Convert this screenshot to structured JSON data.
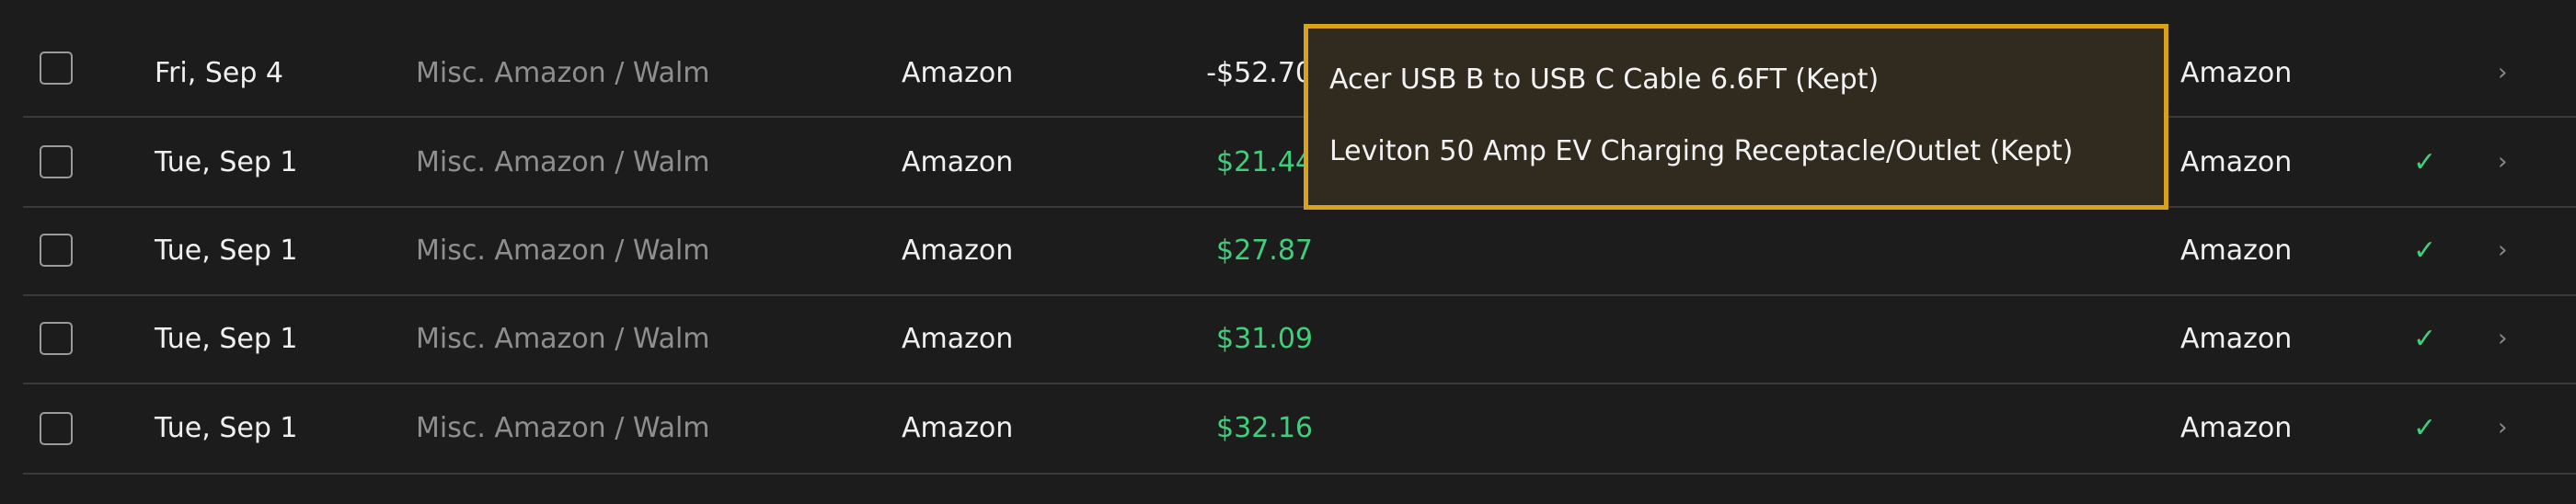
{
  "transactions": [
    {
      "date": "Fri, Sep 4",
      "category": "Misc. Amazon / Walm",
      "merchant": "Amazon",
      "amount": "-$52.70",
      "account": "Amazon",
      "reviewed": false,
      "check": "",
      "chevron": "›",
      "amount_color": "#f0f0f0"
    },
    {
      "date": "Tue, Sep 1",
      "category": "Misc. Amazon / Walm",
      "merchant": "Amazon",
      "amount": "$21.44",
      "account": "Amazon",
      "reviewed": true,
      "check": "✓",
      "chevron": "›",
      "amount_color": "#3fcf7a"
    },
    {
      "date": "Tue, Sep 1",
      "category": "Misc. Amazon / Walm",
      "merchant": "Amazon",
      "amount": "$27.87",
      "account": "Amazon",
      "reviewed": true,
      "check": "✓",
      "chevron": "›",
      "amount_color": "#3fcf7a"
    },
    {
      "date": "Tue, Sep 1",
      "category": "Misc. Amazon / Walm",
      "merchant": "Amazon",
      "amount": "$31.09",
      "account": "Amazon",
      "reviewed": true,
      "check": "✓",
      "chevron": "›",
      "amount_color": "#3fcf7a"
    },
    {
      "date": "Tue, Sep 1",
      "category": "Misc. Amazon / Walm",
      "merchant": "Amazon",
      "amount": "$32.16",
      "account": "Amazon",
      "reviewed": true,
      "check": "✓",
      "chevron": "›",
      "amount_color": "#3fcf7a"
    }
  ],
  "tooltip": {
    "items": [
      "Acer USB B to USB C Cable 6.6FT (Kept)",
      "Leviton 50 Amp EV Charging Receptacle/Outlet (Kept)"
    ],
    "border_color": "#d9a21b"
  },
  "icons": {
    "checkbox": "checkbox-icon",
    "reviewed": "checkmark-icon",
    "chevron": "chevron-right-icon"
  }
}
